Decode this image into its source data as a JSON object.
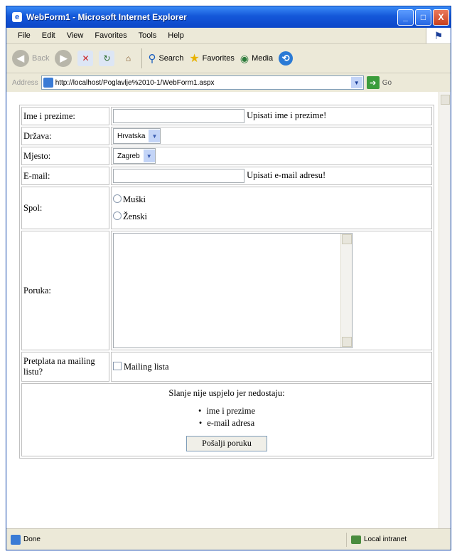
{
  "window": {
    "title": "WebForm1 - Microsoft Internet Explorer",
    "ie_glyph": "e",
    "minimize": "_",
    "maximize": "□",
    "close": "X"
  },
  "menu": {
    "file": "File",
    "edit": "Edit",
    "view": "View",
    "favorites": "Favorites",
    "tools": "Tools",
    "help": "Help"
  },
  "toolbar": {
    "back": "Back",
    "search": "Search",
    "favorites": "Favorites",
    "media": "Media"
  },
  "address": {
    "label": "Address",
    "url": "http://localhost/Poglavlje%2010-1/WebForm1.aspx",
    "go": "Go"
  },
  "form": {
    "name_label": "Ime i prezime:",
    "name_value": "",
    "name_error": "Upisati ime i prezime!",
    "country_label": "Država:",
    "country_value": "Hrvatska",
    "city_label": "Mjesto:",
    "city_value": "Zagreb",
    "email_label": "E-mail:",
    "email_value": "",
    "email_error": "Upisati e-mail adresu!",
    "gender_label": "Spol:",
    "gender_male": "Muški",
    "gender_female": "Ženski",
    "message_label": "Poruka:",
    "mailing_label": "Pretplata na mailing listu?",
    "mailing_checkbox": "Mailing lista"
  },
  "validation": {
    "header": "Slanje nije uspjelo jer nedostaju:",
    "items": [
      "ime i prezime",
      "e-mail adresa"
    ]
  },
  "submit_label": "Pošalji poruku",
  "status": {
    "left": "Done",
    "zone": "Local intranet"
  }
}
